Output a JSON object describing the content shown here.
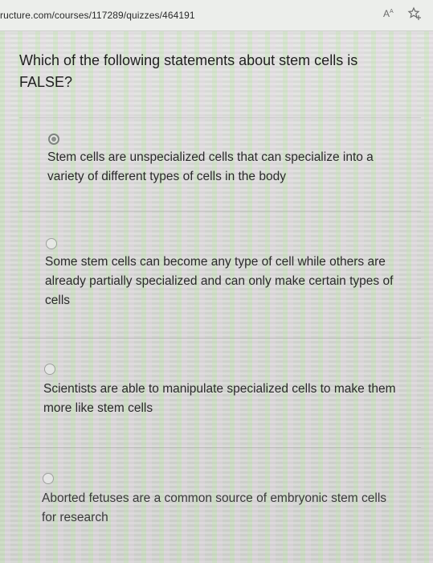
{
  "browser": {
    "url": "ructure.com/courses/117289/quizzes/464191",
    "reader_icon": "text-size-icon",
    "favorite_icon": "star-add-icon"
  },
  "quiz": {
    "question": "Which of the following statements about stem cells is FALSE?",
    "options": [
      {
        "label": "Stem cells are unspecialized cells that can specialize into a variety of different types of cells in the body",
        "selected": true
      },
      {
        "label": "Some stem cells can become any type of cell while others are already partially specialized and can only make certain types of cells",
        "selected": false
      },
      {
        "label": "Scientists are able to manipulate specialized cells to make them more like stem cells",
        "selected": false
      },
      {
        "label": "Aborted fetuses are a common source of embryonic stem cells for research",
        "selected": false
      }
    ]
  }
}
